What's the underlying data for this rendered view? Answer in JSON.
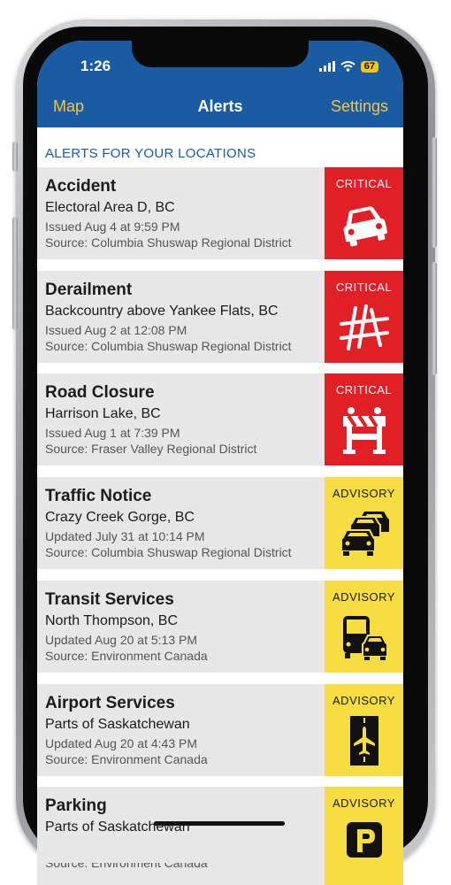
{
  "status_bar": {
    "time": "1:26",
    "battery": "67"
  },
  "nav": {
    "left": "Map",
    "title": "Alerts",
    "right": "Settings"
  },
  "section_title": "ALERTS FOR YOUR LOCATIONS",
  "alerts": [
    {
      "title": "Accident",
      "location": "Electoral Area D, BC",
      "issued": "Issued Aug 4 at 9:59 PM",
      "source": "Source: Columbia Shuswap Regional District",
      "level": "CRITICAL",
      "icon": "car-crash-icon"
    },
    {
      "title": "Derailment",
      "location": "Backcountry above Yankee Flats, BC",
      "issued": "Issued Aug 2 at 12:08 PM",
      "source": "Source: Columbia Shuswap Regional District",
      "level": "CRITICAL",
      "icon": "derailment-icon"
    },
    {
      "title": "Road Closure",
      "location": "Harrison Lake, BC",
      "issued": "Issued Aug 1 at 7:39 PM",
      "source": "Source: Fraser Valley Regional District",
      "level": "CRITICAL",
      "icon": "road-barrier-icon"
    },
    {
      "title": "Traffic Notice",
      "location": "Crazy Creek Gorge, BC",
      "issued": "Updated July 31 at 10:14 PM",
      "source": "Source: Columbia Shuswap Regional District",
      "level": "ADVISORY",
      "icon": "traffic-cars-icon"
    },
    {
      "title": "Transit Services",
      "location": "North Thompson, BC",
      "issued": "Updated Aug 20 at 5:13 PM",
      "source": "Source: Environment Canada",
      "level": "ADVISORY",
      "icon": "bus-car-icon"
    },
    {
      "title": "Airport Services",
      "location": "Parts of Saskatchewan",
      "issued": "Updated Aug 20 at 4:43 PM",
      "source": "Source: Environment Canada",
      "level": "ADVISORY",
      "icon": "airplane-runway-icon"
    },
    {
      "title": "Parking",
      "location": "Parts of Saskatchewan",
      "issued": "",
      "source": "Source: Environment Canada",
      "level": "ADVISORY",
      "icon": "parking-icon"
    }
  ],
  "colors": {
    "header_blue": "#1a5ca3",
    "nav_accent": "#f6c24a",
    "critical": "#e01f26",
    "advisory": "#f7dd41",
    "card_bg": "#e7e7e8"
  }
}
